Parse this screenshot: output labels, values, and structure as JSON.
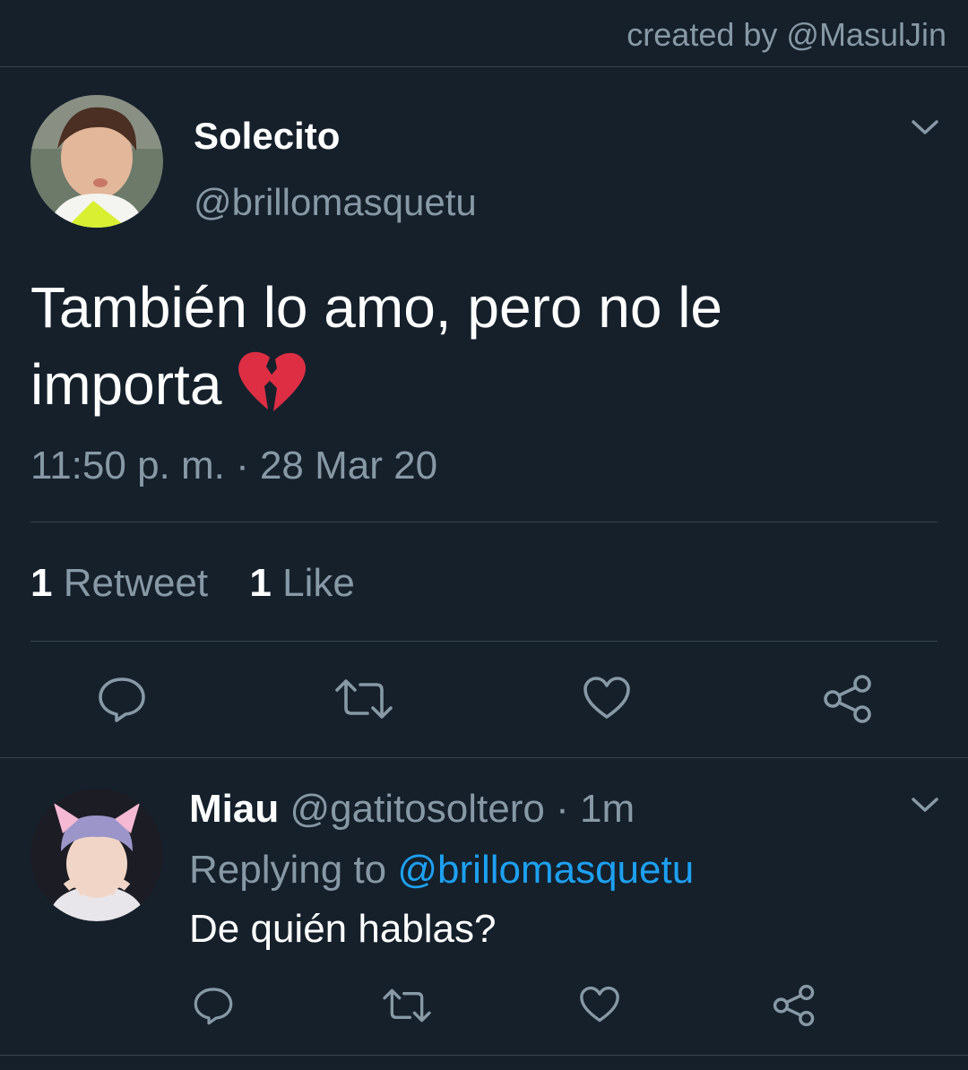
{
  "credit": "created by @MasulJin",
  "tweet": {
    "name": "Solecito",
    "handle": "@brillomasquetu",
    "text_line1": "También lo amo, pero no le",
    "text_line2": "importa",
    "emoji": "broken-heart-emoji",
    "timestamp": "11:50 p. m. · 28 Mar 20",
    "retweet_count": "1",
    "retweet_label": "Retweet",
    "like_count": "1",
    "like_label": "Like"
  },
  "reply": {
    "name": "Miau",
    "handle": "@gatitosoltero",
    "separator": "·",
    "time": "1m",
    "replying_to_label": "Replying to",
    "replying_to_handle": "@brillomasquetu",
    "text": "De quién hablas?"
  },
  "icons": [
    "reply-icon",
    "retweet-icon",
    "like-icon",
    "share-icon",
    "chevron-down-icon"
  ],
  "colors": {
    "background": "#15202b",
    "divider": "#38444d",
    "muted_text": "#8899a6",
    "link": "#1da1f2",
    "text": "#ffffff"
  }
}
